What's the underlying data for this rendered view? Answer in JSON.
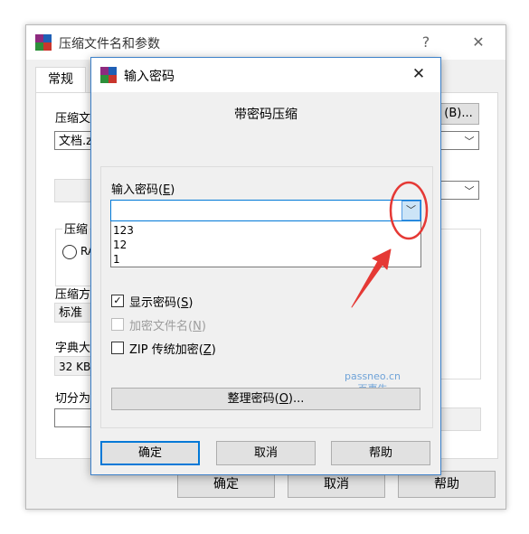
{
  "back_window": {
    "title": "压缩文件名和参数",
    "help": "?",
    "close": "✕",
    "tab_general": "常规",
    "archive_name_label": "压缩文",
    "archive_name_value": "文档.z",
    "browse_button": "(B)...",
    "compression_group_label": "压缩",
    "rar_radio_label": "RA",
    "method_label": "压缩方",
    "method_value": "标准",
    "dict_label": "字典大",
    "dict_value": "32 KB",
    "split_label": "切分为",
    "right_paren": ")",
    "ok_button": "确定",
    "cancel_button": "取消",
    "help_button": "帮助"
  },
  "dialog": {
    "title": "输入密码",
    "close": "✕",
    "heading": "带密码压缩",
    "password_label": "输入密码(",
    "password_label_key": "E",
    "password_label_end": ")",
    "password_value": "",
    "history": [
      "123",
      "12",
      "1"
    ],
    "show_password": "显示密码(",
    "show_password_key": "S",
    "encrypt_names": "加密文件名(",
    "encrypt_names_key": "N",
    "zip_legacy": "ZIP 传统加密(",
    "zip_legacy_key": "Z",
    "paren_close": ")",
    "organize_button": "整理密码(",
    "organize_key": "O",
    "organize_end": ")...",
    "ok_button": "确定",
    "cancel_button": "取消",
    "help_button": "帮助"
  },
  "watermark": {
    "line1": "passneo.cn",
    "line2": "百事牛"
  },
  "colors": {
    "accent": "#0078d7",
    "annotation": "#e53935",
    "watermark": "#6fa3d8"
  }
}
